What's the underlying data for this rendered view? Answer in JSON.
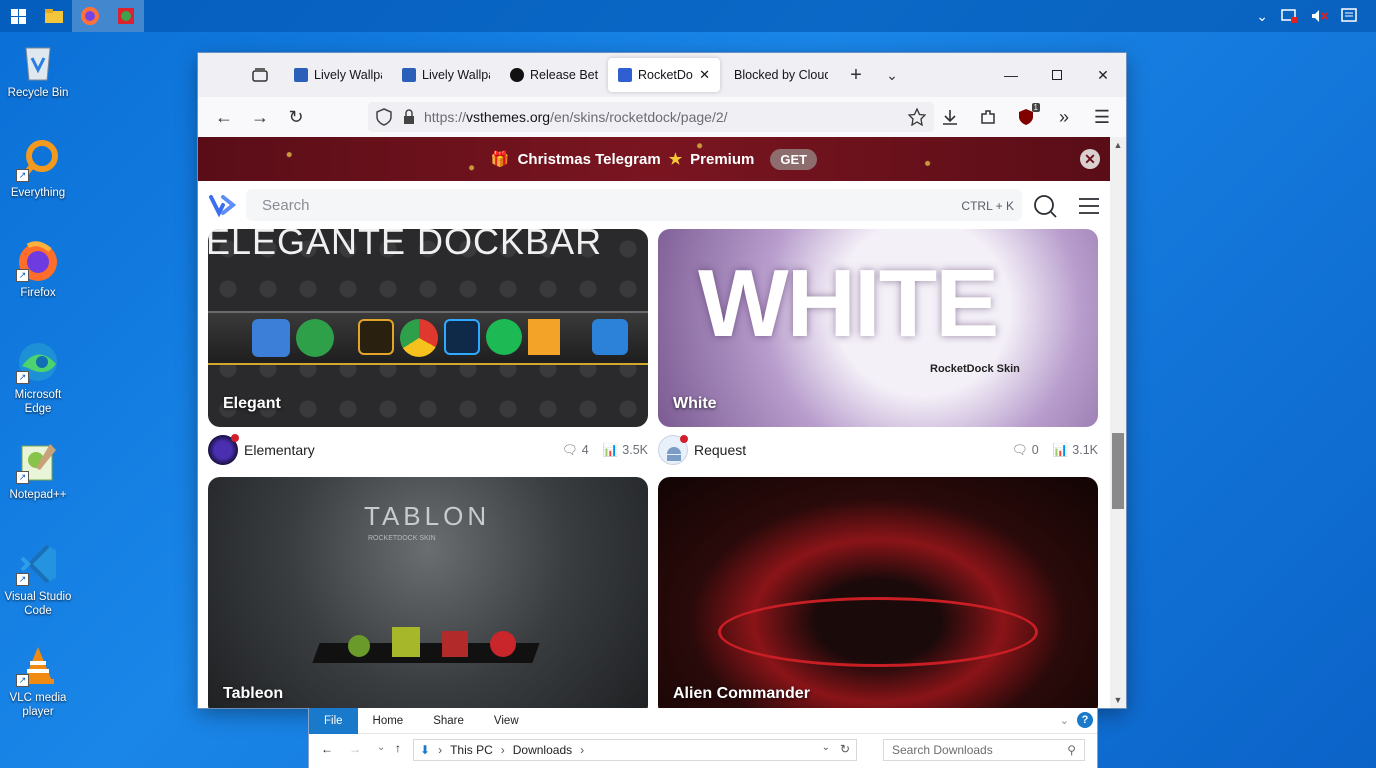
{
  "taskbar": {
    "icons": [
      "windows-icon",
      "file-explorer-icon",
      "firefox-icon",
      "app-icon"
    ]
  },
  "desktop": {
    "icons": [
      {
        "label": "Recycle Bin",
        "icon": "recycle-bin-icon"
      },
      {
        "label": "Everything",
        "icon": "everything-search-icon"
      },
      {
        "label": "Firefox",
        "icon": "firefox-icon"
      },
      {
        "label": "Microsoft Edge",
        "icon": "edge-icon"
      },
      {
        "label": "Notepad++",
        "icon": "notepadpp-icon"
      },
      {
        "label": "Visual Studio Code",
        "icon": "vscode-icon"
      },
      {
        "label": "VLC media player",
        "icon": "vlc-icon"
      }
    ]
  },
  "browser": {
    "tabs": [
      {
        "title": "Lively Wallpa",
        "favicon_color": "#2b5fb8"
      },
      {
        "title": "Lively Wallpa",
        "favicon_color": "#2b5fb8"
      },
      {
        "title": "Release Bette",
        "favicon_color": "#111111"
      },
      {
        "title": "RocketDoc",
        "favicon_color": "#2f5fd0",
        "selected": true
      },
      {
        "title": "Blocked by Cloud",
        "favicon_color": ""
      }
    ],
    "url": "https://vsthemes.org/en/skins/rocketdock/page/2/",
    "url_host": "vsthemes.org",
    "url_prefix": "https://",
    "url_path": "/en/skins/rocketdock/page/2/",
    "extension_badge": "1"
  },
  "site": {
    "banner": {
      "text": "Christmas Telegram",
      "premium": "Premium",
      "get_label": "GET"
    },
    "search_placeholder": "Search",
    "shortcut": "CTRL + K",
    "cards": [
      {
        "title": "Elegant",
        "author": "Elementary",
        "comments": "4",
        "views": "3.5K",
        "theme": "dark-dock"
      },
      {
        "title": "White",
        "author": "Request",
        "comments": "0",
        "views": "3.1K",
        "theme": "white-splash"
      },
      {
        "title": "Tableon",
        "author": "",
        "comments": "",
        "views": "",
        "theme": "tablon"
      },
      {
        "title": "Alien Commander",
        "author": "",
        "comments": "",
        "views": "",
        "theme": "alien-red"
      }
    ],
    "card_texts": {
      "elegant_banner": "ELEGANTE DOCKBAR",
      "white_big": "WHITE",
      "white_sub": "RocketDock Skin",
      "tablon_title": "TABLON",
      "tablon_sub": "ROCKETDOCK SKIN"
    }
  },
  "explorer": {
    "ribbon_tabs": [
      "File",
      "Home",
      "Share",
      "View"
    ],
    "path": [
      "This PC",
      "Downloads"
    ],
    "search_placeholder": "Search Downloads"
  },
  "colors": {
    "accent": "#3b6ef0",
    "banner_bg": "#6a0f1b",
    "explorer_file_tab": "#1979ca"
  }
}
